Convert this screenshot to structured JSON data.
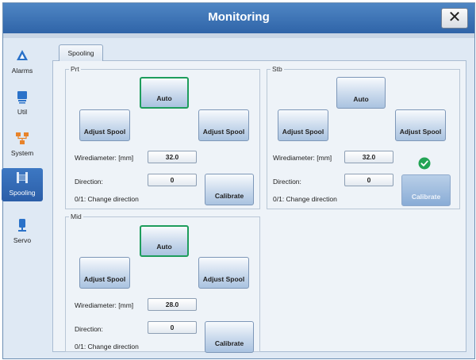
{
  "window": {
    "title": "Monitoring",
    "close_symbol": "✕"
  },
  "nav": {
    "items": [
      {
        "label": "Alarms",
        "icon": "alarm-triangle-icon",
        "active": false
      },
      {
        "label": "Util",
        "icon": "util-monitor-icon",
        "active": false
      },
      {
        "label": "System",
        "icon": "system-network-icon",
        "active": false
      },
      {
        "label": "Spooling",
        "icon": "spool-winch-icon",
        "active": true
      },
      {
        "label": "Servo",
        "icon": "servo-motor-icon",
        "active": false
      }
    ]
  },
  "tab": {
    "label": "Spooling"
  },
  "common": {
    "adjust_label": "Adjust Spool",
    "auto_label": "Auto",
    "calibrate_label": "Calibrate",
    "wirediameter_label": "Wirediameter: [mm]",
    "direction_label": "Direction:",
    "change_direction_label": "0/1: Change direction"
  },
  "groups": {
    "prt": {
      "title": "Prt",
      "wirediameter": "32.0",
      "direction": "0",
      "auto_selected": true,
      "calibrate_enabled": true
    },
    "stb": {
      "title": "Stb",
      "wirediameter": "32.0",
      "direction": "0",
      "auto_selected": false,
      "calibrate_enabled": false,
      "calibrated": true
    },
    "mid": {
      "title": "Mid",
      "wirediameter": "28.0",
      "direction": "0",
      "auto_selected": true,
      "calibrate_enabled": true
    }
  },
  "colors": {
    "title_bar": "#3f77b9",
    "accent_green": "#1e9d5c",
    "active_nav": "#2f66ad"
  }
}
